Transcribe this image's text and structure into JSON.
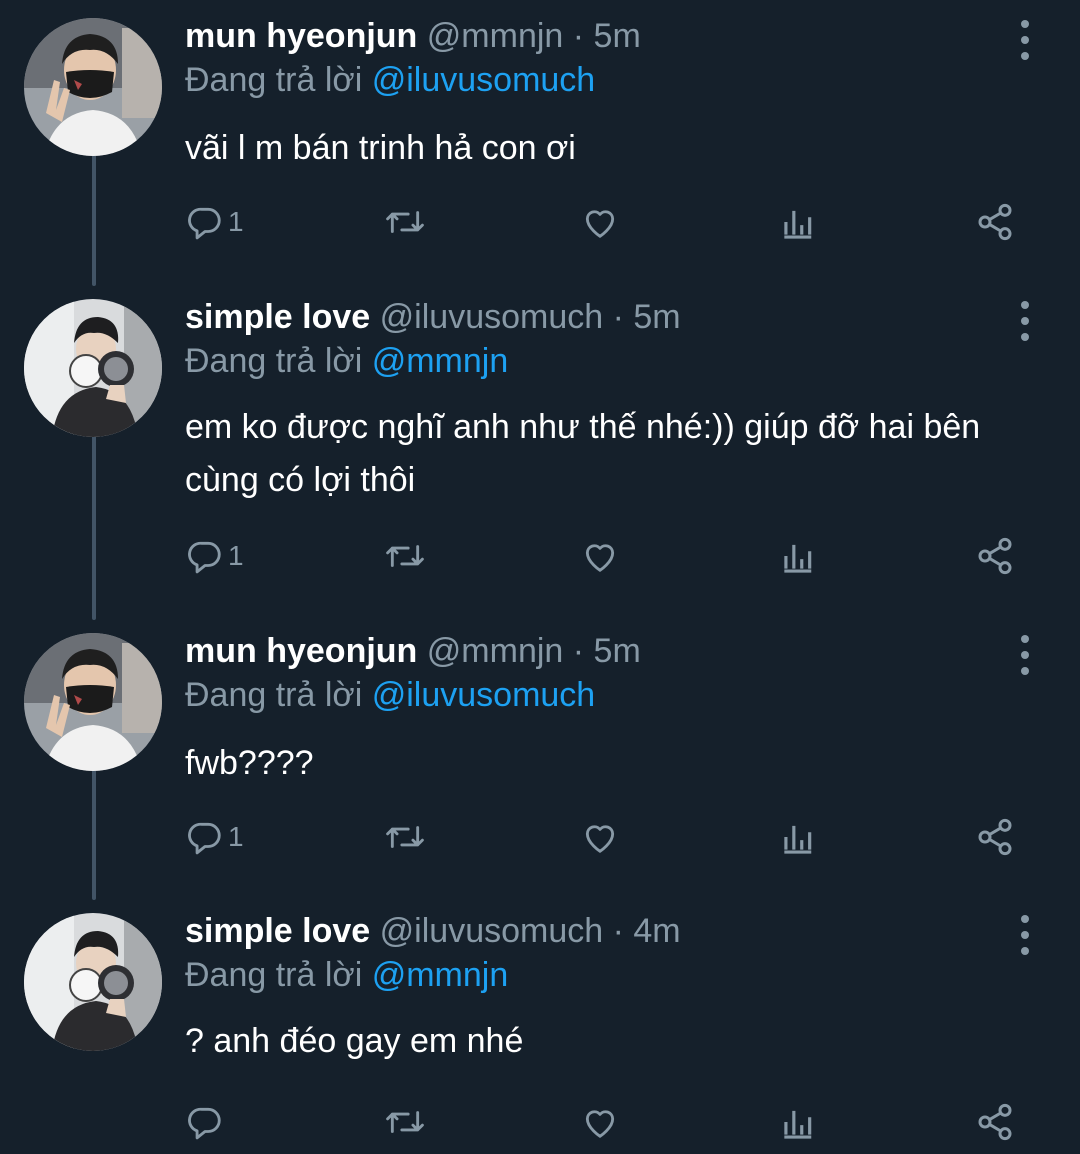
{
  "tweets": [
    {
      "name": "mun hyeonjun",
      "handle": "@mmnjn",
      "sep": "·",
      "time": "5m",
      "reply_prefix": "Đang trả lời",
      "reply_to": "@iluvusomuch",
      "text": "vãi l m bán trinh hả con ơi",
      "reply_count": "1",
      "avatar": "avatar-masked-boy"
    },
    {
      "name": "simple love",
      "handle": "@iluvusomuch",
      "sep": "·",
      "time": "5m",
      "reply_prefix": "Đang trả lời",
      "reply_to": "@mmnjn",
      "text": "em ko được nghĩ anh như thế nhé:)) giúp đỡ hai bên cùng có lợi thôi",
      "reply_count": "1",
      "avatar": "avatar-mirror-boy"
    },
    {
      "name": "mun hyeonjun",
      "handle": "@mmnjn",
      "sep": "·",
      "time": "5m",
      "reply_prefix": "Đang trả lời",
      "reply_to": "@iluvusomuch",
      "text": "fwb????",
      "reply_count": "1",
      "avatar": "avatar-masked-boy"
    },
    {
      "name": "simple love",
      "handle": "@iluvusomuch",
      "sep": "·",
      "time": "4m",
      "reply_prefix": "Đang trả lời",
      "reply_to": "@mmnjn",
      "text": "? anh đéo gay em nhé",
      "reply_count": "",
      "avatar": "avatar-mirror-boy"
    }
  ],
  "icons": {
    "reply": "reply-icon",
    "retweet": "retweet-icon",
    "like": "like-icon",
    "analytics": "analytics-icon",
    "share": "share-icon",
    "more": "more-vertical-icon"
  },
  "colors": {
    "background": "#15202b",
    "text": "#ffffff",
    "muted": "#8899a6",
    "mention": "#1da1f2",
    "thread_line": "#425466"
  }
}
